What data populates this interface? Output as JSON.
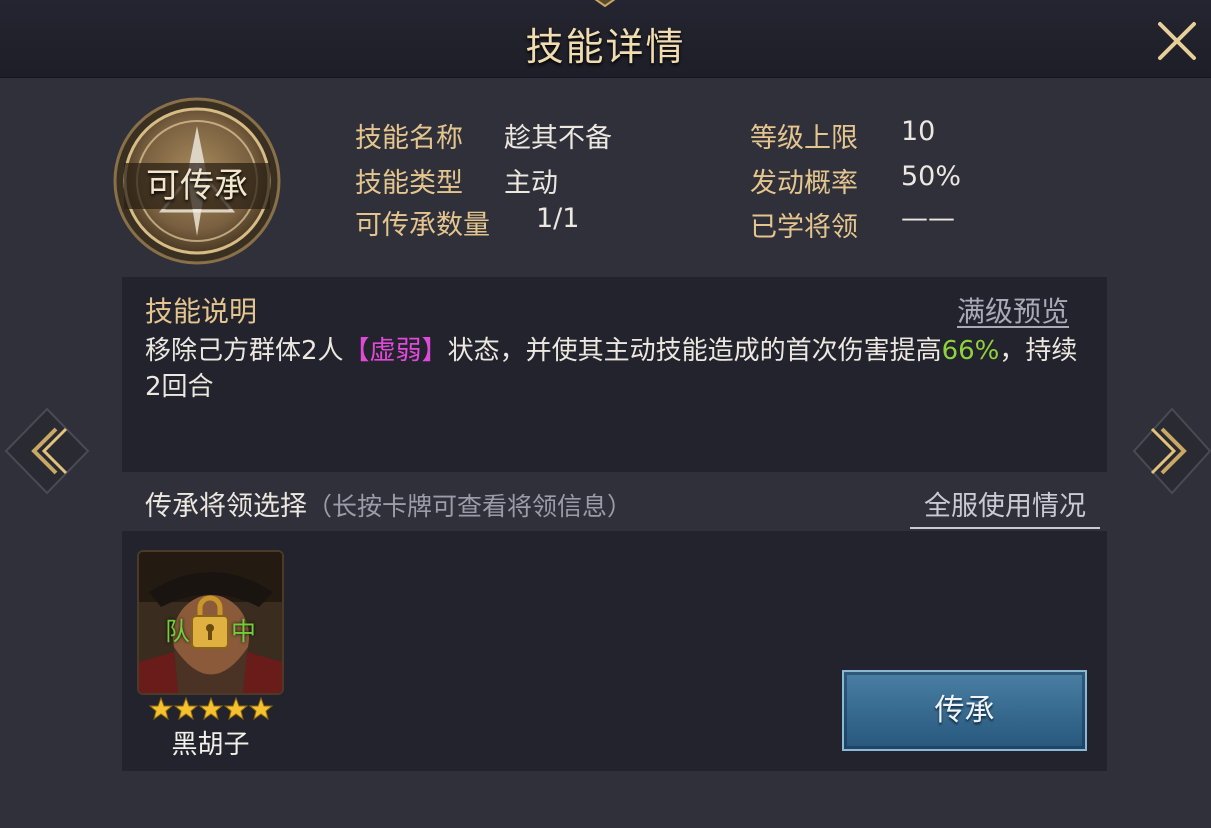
{
  "header": {
    "title": "技能详情"
  },
  "emblem": {
    "label": "可传承"
  },
  "skill_info": {
    "name_label": "技能名称",
    "name_value": "趁其不备",
    "type_label": "技能类型",
    "type_value": "主动",
    "inherit_count_label": "可传承数量",
    "inherit_count_value": "1/1",
    "level_cap_label": "等级上限",
    "level_cap_value": "10",
    "trigger_rate_label": "发动概率",
    "trigger_rate_value": "50%",
    "learned_label": "已学将领",
    "learned_value": "——"
  },
  "description": {
    "title": "技能说明",
    "full_level_link": "满级预览",
    "text_part1": "移除己方群体2人",
    "status_tag": "【虚弱】",
    "text_part2": "状态，并使其主动技能造成的首次伤害提高",
    "bonus": "66%",
    "text_part3": "，持续2回合"
  },
  "heir_section": {
    "title": "传承将领选择",
    "hint": "（长按卡牌可查看将领信息）",
    "usage_link": "全服使用情况"
  },
  "hero_card": {
    "name": "黑胡子",
    "stars": 5,
    "team_tag_left": "队",
    "team_tag_right": "中"
  },
  "actions": {
    "inherit_button": "传承"
  },
  "colors": {
    "label_gold": "#e4c58e",
    "status_pink": "#e14ad8",
    "bonus_green": "#8fd23c",
    "button_blue": "#3a6f95"
  },
  "icons": [
    "close-icon",
    "lock-icon",
    "star-icon",
    "prev-arrow-icon",
    "next-arrow-icon",
    "skill-emblem-icon"
  ]
}
